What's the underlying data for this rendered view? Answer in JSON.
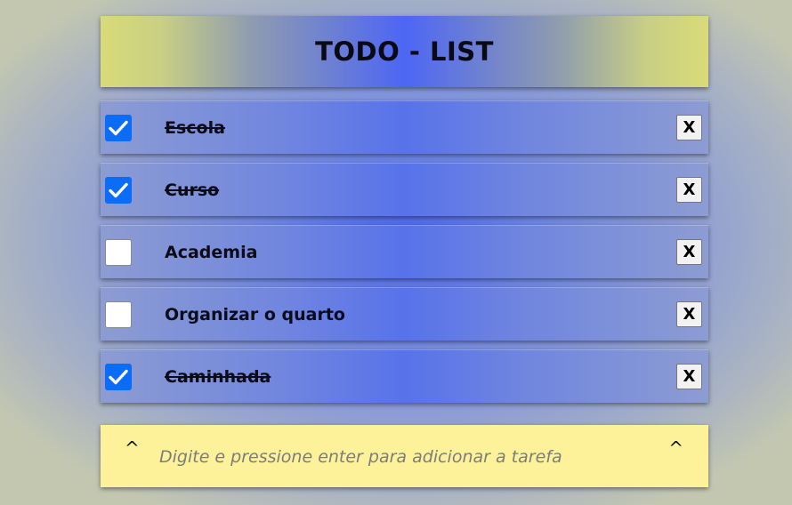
{
  "header": {
    "title": "TODO - LIST"
  },
  "tasks": [
    {
      "label": "Escola",
      "done": true,
      "delete_label": "X"
    },
    {
      "label": "Curso",
      "done": true,
      "delete_label": "X"
    },
    {
      "label": "Academia",
      "done": false,
      "delete_label": "X"
    },
    {
      "label": "Organizar o quarto",
      "done": false,
      "delete_label": "X"
    },
    {
      "label": "Caminhada",
      "done": true,
      "delete_label": "X"
    }
  ],
  "new_task": {
    "placeholder": "Digite e pressione enter para adicionar a tarefa",
    "value": "",
    "left_caret": "^",
    "right_caret": "^"
  },
  "colors": {
    "checkbox_checked": "#0b6cf7",
    "input_background": "#fdf29a",
    "header_edge": "#d9db78",
    "accent_blue": "#4d66f4"
  }
}
